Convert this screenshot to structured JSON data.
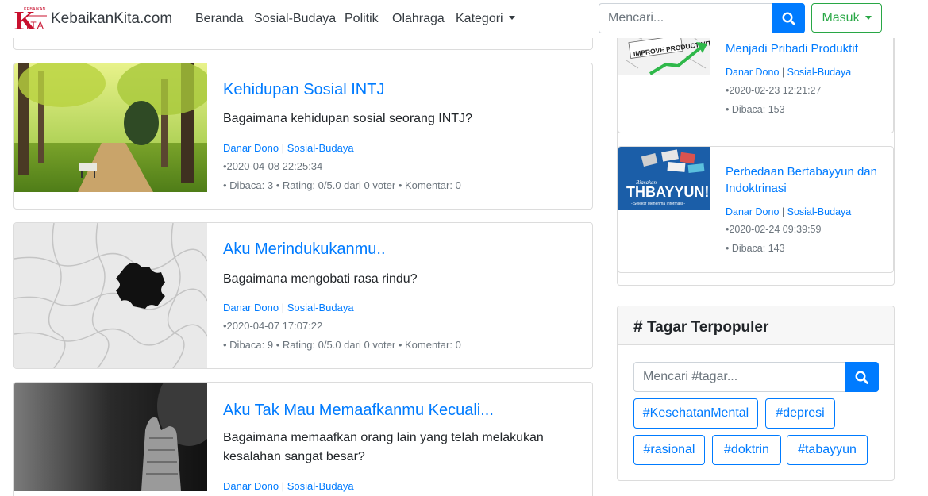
{
  "navbar": {
    "logo_small_text": "KEBAIKAN",
    "logo_letters": "K",
    "logo_sub": "ITA",
    "brand": "KebaikanKita.com",
    "links": [
      "Beranda",
      "Sosial-Budaya",
      "Politik",
      "Olahraga",
      "Kategori"
    ],
    "search_placeholder": "Mencari...",
    "login_label": "Masuk"
  },
  "articles": [
    {
      "title": "Kehidupan Sosial INTJ",
      "desc": "Bagaimana kehidupan sosial seorang INTJ?",
      "author": "Danar Dono",
      "category": "Sosial-Budaya",
      "date": "•2020-04-08 22:25:34",
      "stats": "• Dibaca: 3 • Rating: 0/5.0 dari 0 voter • Komentar: 0"
    },
    {
      "title": "Aku Merindukukanmu..",
      "desc": "Bagaimana mengobati rasa rindu?",
      "author": "Danar Dono",
      "category": "Sosial-Budaya",
      "date": "•2020-04-07 17:07:22",
      "stats": "• Dibaca: 9 • Rating: 0/5.0 dari 0 voter • Komentar: 0"
    },
    {
      "title": "Aku Tak Mau Memaafkanmu Kecuali...",
      "desc": "Bagaimana memaafkan orang lain yang telah melakukan kesalahan sangat besar?",
      "author": "Danar Dono",
      "category": "Sosial-Budaya"
    }
  ],
  "sidebar": {
    "items": [
      {
        "title": "Menjadi Pribadi Produktif",
        "thumb_text": "IMPROVE PRODUCTIVITY",
        "author": "Danar Dono",
        "category": "Sosial-Budaya",
        "date": "•2020-02-23 12:21:27",
        "views": "• Dibaca: 153"
      },
      {
        "title": "Perbedaan Bertabayyun dan Indoktrinasi",
        "thumb_text": "THBAYYUN!",
        "thumb_small": "Biasakan",
        "thumb_sub": "- Selektif Menerima Informasi -",
        "author": "Danar Dono",
        "category": "Sosial-Budaya",
        "date": "•2020-02-24 09:39:59",
        "views": "• Dibaca: 143"
      }
    ],
    "tags": {
      "title": "Tagar Terpopuler",
      "search_placeholder": "Mencari #tagar...",
      "items": [
        "#KesehatanMental",
        "#depresi",
        "#rasional",
        "#doktrin",
        "#tabayyun"
      ]
    }
  },
  "colors": {
    "link": "#007bff",
    "success": "#28a745",
    "border": "#dcdcdc"
  }
}
